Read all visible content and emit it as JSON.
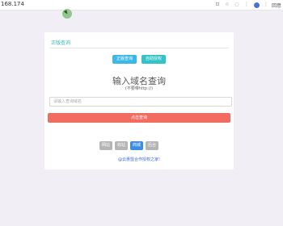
{
  "browser": {
    "address": "168.174",
    "right_label": "回意"
  },
  "card": {
    "section_title": "正版查询",
    "tabs": [
      {
        "label": "正版查询"
      },
      {
        "label": "自助授权"
      }
    ],
    "headline": "输入域名查询",
    "subhead": "(不要带http://)",
    "search_placeholder": "请输入查询域名",
    "query_button": "点击查询",
    "actions": [
      {
        "label": "网站"
      },
      {
        "label": "收站"
      },
      {
        "label": "商城"
      },
      {
        "label": "后台"
      }
    ],
    "footer_note": "@云惠盟合作授权之家!"
  }
}
